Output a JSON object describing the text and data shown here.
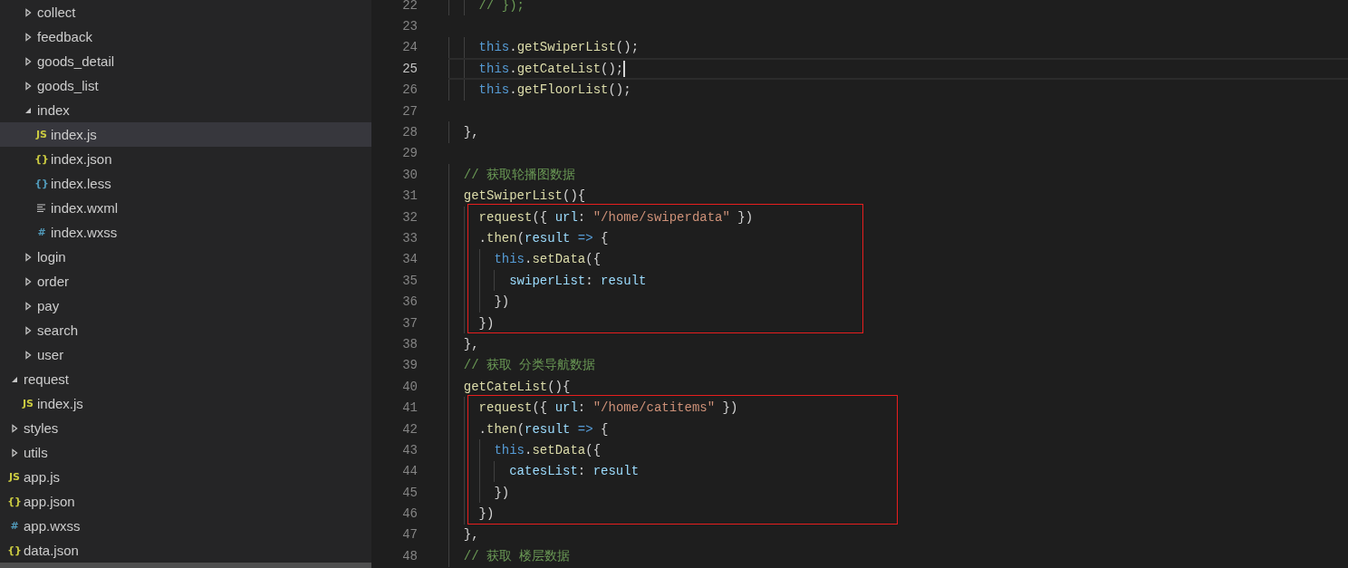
{
  "explorer": {
    "items": [
      {
        "kind": "folder",
        "expanded": true,
        "children": [
          {
            "kind": "folder",
            "label": "collect",
            "expanded": false,
            "selected": false
          },
          {
            "kind": "folder",
            "label": "feedback",
            "expanded": false,
            "selected": false
          },
          {
            "kind": "folder",
            "label": "goods_detail",
            "expanded": false,
            "selected": false
          },
          {
            "kind": "folder",
            "label": "goods_list",
            "expanded": false,
            "selected": false
          },
          {
            "kind": "folder",
            "label": "index",
            "expanded": true,
            "selected": false,
            "children": [
              {
                "kind": "js",
                "glyph": "JS",
                "label": "index.js",
                "selected": true
              },
              {
                "kind": "json",
                "glyph": "{}",
                "label": "index.json",
                "selected": false
              },
              {
                "kind": "less",
                "glyph": "{}",
                "label": "index.less",
                "selected": false
              },
              {
                "kind": "wxml",
                "label": "index.wxml",
                "selected": false
              },
              {
                "kind": "wxss",
                "glyph": "#",
                "label": "index.wxss",
                "selected": false
              }
            ]
          },
          {
            "kind": "folder",
            "label": "login",
            "expanded": false,
            "selected": false
          },
          {
            "kind": "folder",
            "label": "order",
            "expanded": false,
            "selected": false
          },
          {
            "kind": "folder",
            "label": "pay",
            "expanded": false,
            "selected": false
          },
          {
            "kind": "folder",
            "label": "search",
            "expanded": false,
            "selected": false
          },
          {
            "kind": "folder",
            "label": "user",
            "expanded": false,
            "selected": false
          }
        ]
      },
      {
        "kind": "folder",
        "label": "request",
        "expanded": true,
        "selected": false,
        "children": [
          {
            "kind": "js",
            "glyph": "JS",
            "label": "index.js",
            "selected": false
          }
        ]
      },
      {
        "kind": "folder",
        "label": "styles",
        "expanded": false,
        "selected": false
      },
      {
        "kind": "folder",
        "label": "utils",
        "expanded": false,
        "selected": false
      },
      {
        "kind": "js",
        "glyph": "JS",
        "label": "app.js",
        "selected": false
      },
      {
        "kind": "json",
        "glyph": "{}",
        "label": "app.json",
        "selected": false
      },
      {
        "kind": "wxss",
        "glyph": "#",
        "label": "app.wxss",
        "selected": false
      },
      {
        "kind": "json",
        "glyph": "{}",
        "label": "data.json",
        "selected": false
      }
    ]
  },
  "editor": {
    "lines": [
      {
        "number": "22",
        "tokens": [
          {
            "kind": "comment",
            "text": "    // });"
          }
        ]
      },
      {
        "number": "23"
      },
      {
        "number": "24",
        "tokens": [
          {
            "kind": "keyword",
            "text": "    this"
          },
          {
            "kind": "plain",
            "text": "."
          },
          {
            "kind": "function",
            "text": "getSwiperList"
          },
          {
            "kind": "plain",
            "text": "();"
          }
        ]
      },
      {
        "number": "25",
        "current": true,
        "tokens": [
          {
            "kind": "keyword",
            "text": "    this"
          },
          {
            "kind": "plain",
            "text": "."
          },
          {
            "kind": "function",
            "text": "getCateList"
          },
          {
            "kind": "plain",
            "text": "();"
          }
        ]
      },
      {
        "number": "26",
        "tokens": [
          {
            "kind": "keyword",
            "text": "    this"
          },
          {
            "kind": "plain",
            "text": "."
          },
          {
            "kind": "function",
            "text": "getFloorList"
          },
          {
            "kind": "plain",
            "text": "();"
          }
        ]
      },
      {
        "number": "27"
      },
      {
        "number": "28",
        "tokens": [
          {
            "kind": "plain",
            "text": "  },"
          }
        ]
      },
      {
        "number": "29"
      },
      {
        "number": "30",
        "tokens": [
          {
            "kind": "comment",
            "text": "  // 获取轮播图数据"
          }
        ]
      },
      {
        "number": "31",
        "tokens": [
          {
            "kind": "function",
            "text": "  getSwiperList"
          },
          {
            "kind": "plain",
            "text": "(){"
          }
        ]
      },
      {
        "number": "32",
        "boxed": true,
        "tokens": [
          {
            "kind": "function",
            "text": "    request"
          },
          {
            "kind": "plain",
            "text": "({ "
          },
          {
            "kind": "variable",
            "text": "url"
          },
          {
            "kind": "plain",
            "text": ": "
          },
          {
            "kind": "string",
            "text": "\"/home/swiperdata\""
          },
          {
            "kind": "plain",
            "text": " })"
          }
        ]
      },
      {
        "number": "33",
        "boxed": true,
        "tokens": [
          {
            "kind": "plain",
            "text": "    ."
          },
          {
            "kind": "function",
            "text": "then"
          },
          {
            "kind": "plain",
            "text": "("
          },
          {
            "kind": "variable",
            "text": "result"
          },
          {
            "kind": "keyword",
            "text": " =>"
          },
          {
            "kind": "plain",
            "text": " {"
          }
        ]
      },
      {
        "number": "34",
        "boxed": true,
        "tokens": [
          {
            "kind": "keyword",
            "text": "      this"
          },
          {
            "kind": "plain",
            "text": "."
          },
          {
            "kind": "function",
            "text": "setData"
          },
          {
            "kind": "plain",
            "text": "({"
          }
        ]
      },
      {
        "number": "35",
        "boxed": true,
        "tokens": [
          {
            "kind": "variable",
            "text": "        swiperList"
          },
          {
            "kind": "plain",
            "text": ": "
          },
          {
            "kind": "variable",
            "text": "result"
          }
        ]
      },
      {
        "number": "36",
        "boxed": true,
        "tokens": [
          {
            "kind": "plain",
            "text": "      })"
          }
        ]
      },
      {
        "number": "37",
        "boxed": true,
        "tokens": [
          {
            "kind": "plain",
            "text": "    })"
          }
        ]
      },
      {
        "number": "38",
        "tokens": [
          {
            "kind": "plain",
            "text": "  },"
          }
        ]
      },
      {
        "number": "39",
        "tokens": [
          {
            "kind": "comment",
            "text": "  // 获取 分类导航数据"
          }
        ]
      },
      {
        "number": "40",
        "tokens": [
          {
            "kind": "function",
            "text": "  getCateList"
          },
          {
            "kind": "plain",
            "text": "(){"
          }
        ]
      },
      {
        "number": "41",
        "boxed": true,
        "tokens": [
          {
            "kind": "function",
            "text": "    request"
          },
          {
            "kind": "plain",
            "text": "({ "
          },
          {
            "kind": "variable",
            "text": "url"
          },
          {
            "kind": "plain",
            "text": ": "
          },
          {
            "kind": "string",
            "text": "\"/home/catitems\""
          },
          {
            "kind": "plain",
            "text": " })"
          }
        ]
      },
      {
        "number": "42",
        "boxed": true,
        "tokens": [
          {
            "kind": "plain",
            "text": "    ."
          },
          {
            "kind": "function",
            "text": "then"
          },
          {
            "kind": "plain",
            "text": "("
          },
          {
            "kind": "variable",
            "text": "result"
          },
          {
            "kind": "keyword",
            "text": " =>"
          },
          {
            "kind": "plain",
            "text": " {"
          }
        ]
      },
      {
        "number": "43",
        "boxed": true,
        "tokens": [
          {
            "kind": "keyword",
            "text": "      this"
          },
          {
            "kind": "plain",
            "text": "."
          },
          {
            "kind": "function",
            "text": "setData"
          },
          {
            "kind": "plain",
            "text": "({"
          }
        ]
      },
      {
        "number": "44",
        "boxed": true,
        "tokens": [
          {
            "kind": "variable",
            "text": "        catesList"
          },
          {
            "kind": "plain",
            "text": ": "
          },
          {
            "kind": "variable",
            "text": "result"
          }
        ]
      },
      {
        "number": "45",
        "boxed": true,
        "tokens": [
          {
            "kind": "plain",
            "text": "      })"
          }
        ]
      },
      {
        "number": "46",
        "boxed": true,
        "tokens": [
          {
            "kind": "plain",
            "text": "    })"
          }
        ]
      },
      {
        "number": "47",
        "tokens": [
          {
            "kind": "plain",
            "text": "  },"
          }
        ]
      },
      {
        "number": "48",
        "tokens": [
          {
            "kind": "comment",
            "text": "  // 获取 楼层数据"
          }
        ]
      }
    ]
  }
}
